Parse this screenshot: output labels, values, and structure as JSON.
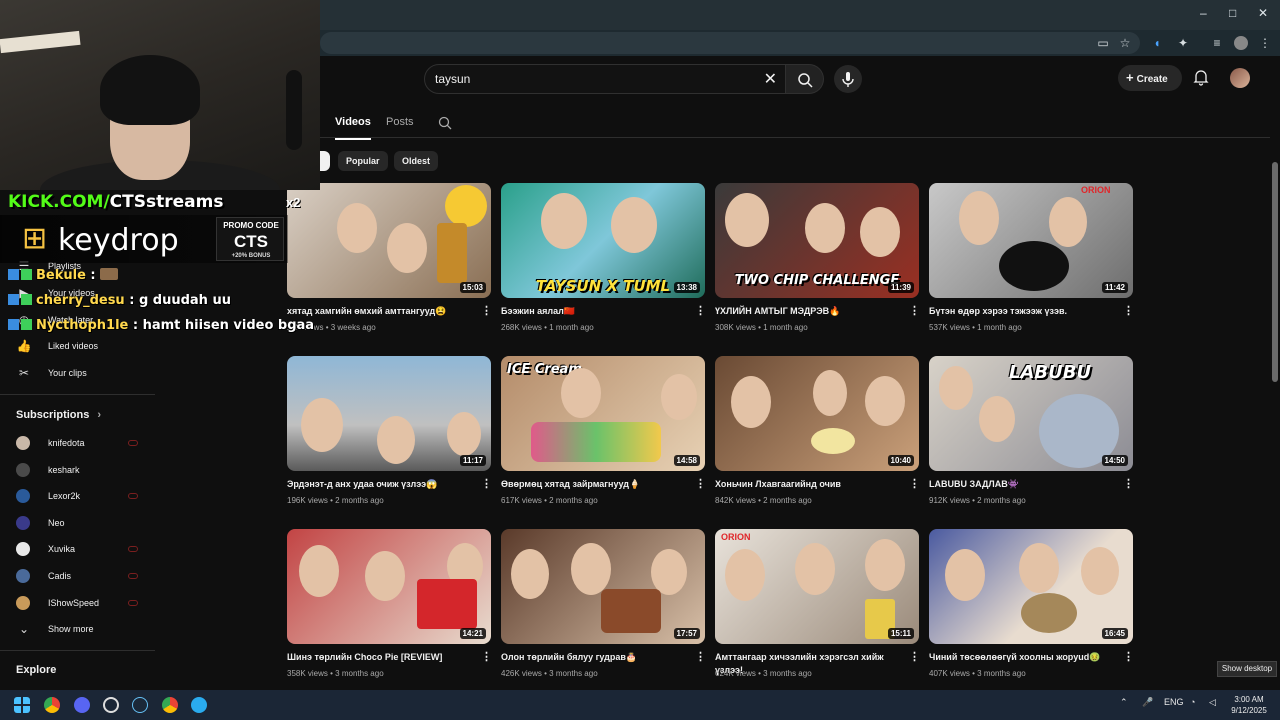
{
  "browser": {
    "title_controls": [
      "–",
      "□",
      "✕"
    ]
  },
  "search": {
    "query": "taysun"
  },
  "header": {
    "create_label": "Create"
  },
  "tabs": {
    "videos": "Videos",
    "posts": "Posts"
  },
  "filters": {
    "popular": "Popular",
    "oldest": "Oldest"
  },
  "sidebar": {
    "items": {
      "playlists": "Playlists",
      "your_videos": "Your videos",
      "watch_later": "Watch later",
      "liked_videos": "Liked videos",
      "your_clips": "Your clips"
    },
    "subscriptions_heading": "Subscriptions",
    "subscriptions": [
      {
        "name": "knifedota",
        "color": "#c9b8a8"
      },
      {
        "name": "keshark",
        "color": "#4a4a4a"
      },
      {
        "name": "Lexor2k",
        "color": "#2a5a9a"
      },
      {
        "name": "Neo",
        "color": "#3a3a8a"
      },
      {
        "name": "Xuvika",
        "color": "#e8e8e8"
      },
      {
        "name": "Cadis",
        "color": "#4a6a9a"
      },
      {
        "name": "IShowSpeed",
        "color": "#c89a5a"
      }
    ],
    "show_more": "Show more",
    "explore_heading": "Explore"
  },
  "videos": [
    {
      "title": "хятад хамгийн өмхий амттангууд😫",
      "views": "25K views",
      "age": "3 weeks ago",
      "duration": "15:03"
    },
    {
      "title": "Бээжин аялал🇨🇳",
      "views": "268K views",
      "age": "1 month ago",
      "duration": "13:38"
    },
    {
      "title": "ҮХЛИЙН АМТЫГ МЭДРЭВ🔥",
      "views": "308K views",
      "age": "1 month ago",
      "duration": "11:39"
    },
    {
      "title": "Бүтэн өдөр хэрээ тэжээж үзэв.",
      "views": "537K views",
      "age": "1 month ago",
      "duration": "11:42"
    },
    {
      "title": "Эрдэнэт-д анх удаа очиж үзлээ😱",
      "views": "196K views",
      "age": "2 months ago",
      "duration": "11:17"
    },
    {
      "title": "Өвөрмөц хятад зайрмагнууд🍦",
      "views": "617K views",
      "age": "2 months ago",
      "duration": "14:58"
    },
    {
      "title": "Хоньчин Лхавгаагийнд очив",
      "views": "842K views",
      "age": "2 months ago",
      "duration": "10:40"
    },
    {
      "title": "LABUBU ЗАДЛАВ👾",
      "views": "912K views",
      "age": "2 months ago",
      "duration": "14:50"
    },
    {
      "title": "Шинэ төрлийн Choco Pie [REVIEW]",
      "views": "358K views",
      "age": "3 months ago",
      "duration": "14:21"
    },
    {
      "title": "Олон төрлийн бялуу гудрав🎂",
      "views": "426K views",
      "age": "3 months ago",
      "duration": "17:57"
    },
    {
      "title": "Амттангаар хичээлийн хэрэгсэл хийж үзлээ!",
      "views": "624K views",
      "age": "3 months ago",
      "duration": "15:11"
    },
    {
      "title": "Чиний төсөөлөөгүй хоолны жоруud🤢",
      "views": "407K views",
      "age": "3 months ago",
      "duration": "16:45"
    }
  ],
  "thumb_texts": {
    "t2": "TAYSUN X TUML",
    "t3": "TWO CHIP CHALLENGE",
    "t6": "ICE Cream",
    "t8": "LABUBU",
    "orion": "ORION"
  },
  "overlay": {
    "kick": "KICK.COM/",
    "kick_channel": "CTSstreams",
    "keydrop": "keydrop",
    "promo_line1": "PROMO CODE",
    "promo_code": "CTS",
    "promo_bonus": "+20% BONUS",
    "multiplier": "x2",
    "chat": [
      {
        "user": "Bekule",
        "text": " : "
      },
      {
        "user": "cherry_desu",
        "text": " : g duudah uu"
      },
      {
        "user": "Nycthoph1le",
        "text": " : hamt hiisen video bgaa"
      }
    ]
  },
  "tooltip": "Show desktop",
  "taskbar": {
    "lang": "ENG",
    "time": "3:00 AM",
    "date": "9/12/2025"
  }
}
